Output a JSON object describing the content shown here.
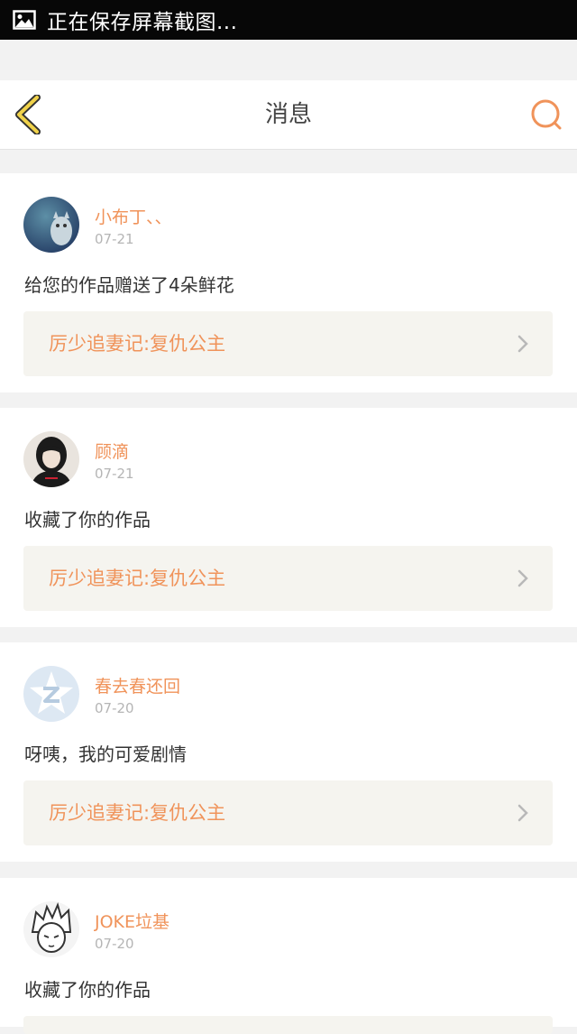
{
  "status_bar": {
    "text": "正在保存屏幕截图..."
  },
  "header": {
    "title": "消息"
  },
  "messages": [
    {
      "username": "小布丁、、",
      "date": "07-21",
      "text": "给您的作品赠送了4朵鲜花",
      "work_title": "厉少追妻记:复仇公主"
    },
    {
      "username": "顾滴",
      "date": "07-21",
      "text": "收藏了你的作品",
      "work_title": "厉少追妻记:复仇公主"
    },
    {
      "username": "春去春还回",
      "date": "07-20",
      "text": "呀咦，我的可爱剧情",
      "work_title": "厉少追妻记:复仇公主"
    },
    {
      "username": "JOKE垃基",
      "date": "07-20",
      "text": "收藏了你的作品",
      "work_title": ""
    }
  ],
  "colors": {
    "accent": "#f0935a",
    "back_icon": "#f0d24a",
    "card_bg": "#f5f4ef"
  }
}
